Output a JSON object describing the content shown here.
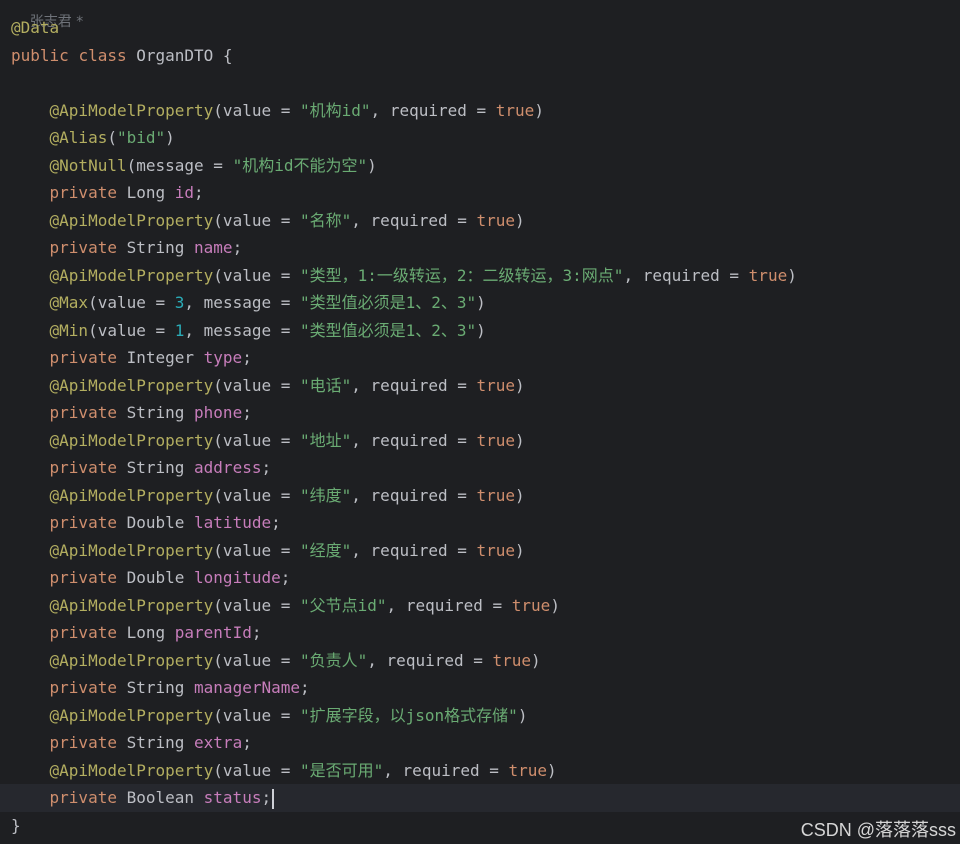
{
  "author_hint": "张志君 *",
  "watermark": "CSDN @落落落sss",
  "colors": {
    "background": "#1e1f22",
    "annotation": "#b3ae60",
    "keyword": "#cf8e6d",
    "string": "#6aab73",
    "number": "#2aacb8",
    "field": "#c77dbb",
    "plain": "#bcbec4"
  },
  "code_lines": [
    [
      [
        "ann",
        "@Data"
      ]
    ],
    [
      [
        "kw",
        "public "
      ],
      [
        "kw",
        "class "
      ],
      [
        "plain",
        "OrganDTO {"
      ]
    ],
    [],
    [
      [
        "plain",
        "    "
      ],
      [
        "ann",
        "@ApiModelProperty"
      ],
      [
        "plain",
        "(value = "
      ],
      [
        "str",
        "\"机构id\""
      ],
      [
        "plain",
        ", required = "
      ],
      [
        "kw",
        "true"
      ],
      [
        "plain",
        ")"
      ]
    ],
    [
      [
        "plain",
        "    "
      ],
      [
        "ann",
        "@Alias"
      ],
      [
        "plain",
        "("
      ],
      [
        "str",
        "\"bid\""
      ],
      [
        "plain",
        ")"
      ]
    ],
    [
      [
        "plain",
        "    "
      ],
      [
        "ann",
        "@NotNull"
      ],
      [
        "plain",
        "(message = "
      ],
      [
        "str",
        "\"机构id不能为空\""
      ],
      [
        "plain",
        ")"
      ]
    ],
    [
      [
        "plain",
        "    "
      ],
      [
        "kw",
        "private "
      ],
      [
        "plain",
        "Long "
      ],
      [
        "field",
        "id"
      ],
      [
        "plain",
        ";"
      ]
    ],
    [
      [
        "plain",
        "    "
      ],
      [
        "ann",
        "@ApiModelProperty"
      ],
      [
        "plain",
        "(value = "
      ],
      [
        "str",
        "\"名称\""
      ],
      [
        "plain",
        ", required = "
      ],
      [
        "kw",
        "true"
      ],
      [
        "plain",
        ")"
      ]
    ],
    [
      [
        "plain",
        "    "
      ],
      [
        "kw",
        "private "
      ],
      [
        "plain",
        "String "
      ],
      [
        "field",
        "name"
      ],
      [
        "plain",
        ";"
      ]
    ],
    [
      [
        "plain",
        "    "
      ],
      [
        "ann",
        "@ApiModelProperty"
      ],
      [
        "plain",
        "(value = "
      ],
      [
        "str",
        "\"类型，1:一级转运，2：二级转运，3:网点\""
      ],
      [
        "plain",
        ", required = "
      ],
      [
        "kw",
        "true"
      ],
      [
        "plain",
        ")"
      ]
    ],
    [
      [
        "plain",
        "    "
      ],
      [
        "ann",
        "@Max"
      ],
      [
        "plain",
        "(value = "
      ],
      [
        "num",
        "3"
      ],
      [
        "plain",
        ", message = "
      ],
      [
        "str",
        "\"类型值必须是1、2、3\""
      ],
      [
        "plain",
        ")"
      ]
    ],
    [
      [
        "plain",
        "    "
      ],
      [
        "ann",
        "@Min"
      ],
      [
        "plain",
        "(value = "
      ],
      [
        "num",
        "1"
      ],
      [
        "plain",
        ", message = "
      ],
      [
        "str",
        "\"类型值必须是1、2、3\""
      ],
      [
        "plain",
        ")"
      ]
    ],
    [
      [
        "plain",
        "    "
      ],
      [
        "kw",
        "private "
      ],
      [
        "plain",
        "Integer "
      ],
      [
        "field",
        "type"
      ],
      [
        "plain",
        ";"
      ]
    ],
    [
      [
        "plain",
        "    "
      ],
      [
        "ann",
        "@ApiModelProperty"
      ],
      [
        "plain",
        "(value = "
      ],
      [
        "str",
        "\"电话\""
      ],
      [
        "plain",
        ", required = "
      ],
      [
        "kw",
        "true"
      ],
      [
        "plain",
        ")"
      ]
    ],
    [
      [
        "plain",
        "    "
      ],
      [
        "kw",
        "private "
      ],
      [
        "plain",
        "String "
      ],
      [
        "field",
        "phone"
      ],
      [
        "plain",
        ";"
      ]
    ],
    [
      [
        "plain",
        "    "
      ],
      [
        "ann",
        "@ApiModelProperty"
      ],
      [
        "plain",
        "(value = "
      ],
      [
        "str",
        "\"地址\""
      ],
      [
        "plain",
        ", required = "
      ],
      [
        "kw",
        "true"
      ],
      [
        "plain",
        ")"
      ]
    ],
    [
      [
        "plain",
        "    "
      ],
      [
        "kw",
        "private "
      ],
      [
        "plain",
        "String "
      ],
      [
        "field",
        "address"
      ],
      [
        "plain",
        ";"
      ]
    ],
    [
      [
        "plain",
        "    "
      ],
      [
        "ann",
        "@ApiModelProperty"
      ],
      [
        "plain",
        "(value = "
      ],
      [
        "str",
        "\"纬度\""
      ],
      [
        "plain",
        ", required = "
      ],
      [
        "kw",
        "true"
      ],
      [
        "plain",
        ")"
      ]
    ],
    [
      [
        "plain",
        "    "
      ],
      [
        "kw",
        "private "
      ],
      [
        "plain",
        "Double "
      ],
      [
        "field",
        "latitude"
      ],
      [
        "plain",
        ";"
      ]
    ],
    [
      [
        "plain",
        "    "
      ],
      [
        "ann",
        "@ApiModelProperty"
      ],
      [
        "plain",
        "(value = "
      ],
      [
        "str",
        "\"经度\""
      ],
      [
        "plain",
        ", required = "
      ],
      [
        "kw",
        "true"
      ],
      [
        "plain",
        ")"
      ]
    ],
    [
      [
        "plain",
        "    "
      ],
      [
        "kw",
        "private "
      ],
      [
        "plain",
        "Double "
      ],
      [
        "field",
        "longitude"
      ],
      [
        "plain",
        ";"
      ]
    ],
    [
      [
        "plain",
        "    "
      ],
      [
        "ann",
        "@ApiModelProperty"
      ],
      [
        "plain",
        "(value = "
      ],
      [
        "str",
        "\"父节点id\""
      ],
      [
        "plain",
        ", required = "
      ],
      [
        "kw",
        "true"
      ],
      [
        "plain",
        ")"
      ]
    ],
    [
      [
        "plain",
        "    "
      ],
      [
        "kw",
        "private "
      ],
      [
        "plain",
        "Long "
      ],
      [
        "field",
        "parentId"
      ],
      [
        "plain",
        ";"
      ]
    ],
    [
      [
        "plain",
        "    "
      ],
      [
        "ann",
        "@ApiModelProperty"
      ],
      [
        "plain",
        "(value = "
      ],
      [
        "str",
        "\"负责人\""
      ],
      [
        "plain",
        ", required = "
      ],
      [
        "kw",
        "true"
      ],
      [
        "plain",
        ")"
      ]
    ],
    [
      [
        "plain",
        "    "
      ],
      [
        "kw",
        "private "
      ],
      [
        "plain",
        "String "
      ],
      [
        "field",
        "managerName"
      ],
      [
        "plain",
        ";"
      ]
    ],
    [
      [
        "plain",
        "    "
      ],
      [
        "ann",
        "@ApiModelProperty"
      ],
      [
        "plain",
        "(value = "
      ],
      [
        "str",
        "\"扩展字段，以json格式存储\""
      ],
      [
        "plain",
        ")"
      ]
    ],
    [
      [
        "plain",
        "    "
      ],
      [
        "kw",
        "private "
      ],
      [
        "plain",
        "String "
      ],
      [
        "field",
        "extra"
      ],
      [
        "plain",
        ";"
      ]
    ],
    [
      [
        "plain",
        "    "
      ],
      [
        "ann",
        "@ApiModelProperty"
      ],
      [
        "plain",
        "(value = "
      ],
      [
        "str",
        "\"是否可用\""
      ],
      [
        "plain",
        ", required = "
      ],
      [
        "kw",
        "true"
      ],
      [
        "plain",
        ")"
      ]
    ],
    [
      [
        "plain",
        "    "
      ],
      [
        "kw",
        "private "
      ],
      [
        "plain",
        "Boolean "
      ],
      [
        "field",
        "status"
      ],
      [
        "plain",
        ";"
      ]
    ],
    [
      [
        "plain",
        "}"
      ]
    ]
  ],
  "current_line": 28
}
